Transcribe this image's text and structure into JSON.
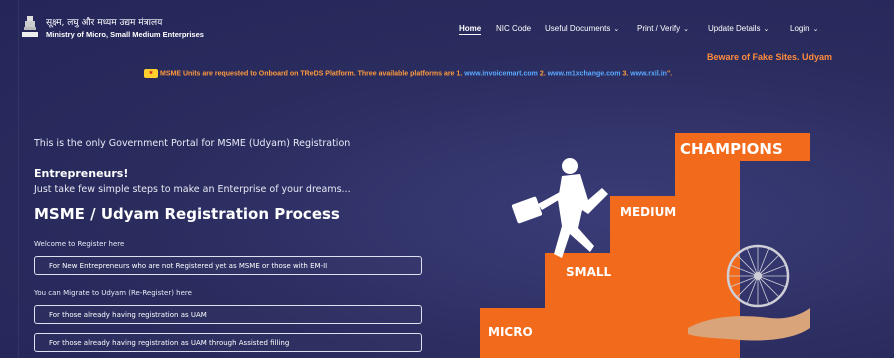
{
  "header": {
    "brand_hindi": "सूक्ष्म, लघु और मध्यम उद्यम मंत्रालय",
    "brand_english": "Ministry of Micro, Small Medium Enterprises",
    "nav": [
      {
        "label": "Home",
        "active": true
      },
      {
        "label": "NIC Code"
      },
      {
        "label": "Useful Documents"
      },
      {
        "label": "Print / Verify"
      },
      {
        "label": "Update Details"
      },
      {
        "label": "Login"
      }
    ]
  },
  "alerts": {
    "fake_warning": "Beware of Fake Sites. Udyam",
    "ticker_text": "MSME Units are requested to Onboard on TReDS Platform. Three available platforms are 1.",
    "ticker_link1": "www.invoicemart.com",
    "ticker_mid1": "2.",
    "ticker_link2": "www.m1xchange.com",
    "ticker_mid2": "3.",
    "ticker_link3": "www.rxil.in",
    "ticker_end": "\"."
  },
  "main": {
    "intro": "This is the only Government Portal for MSME (Udyam) Registration",
    "entre_title": "Entrepreneurs!",
    "entre_sub": "Just take few simple steps to make an Enterprise of your dreams...",
    "process_title": "MSME / Udyam Registration Process",
    "welcome_label": "Welcome to Register here",
    "new_btn": "For New Entrepreneurs who are not Registered yet as MSME or those with EM-II",
    "migrate_label": "You can Migrate to Udyam (Re-Register) here",
    "uam_btn": "For those already having registration as UAM",
    "uam_assisted_btn": "For those already having registration as UAM through Assisted filling"
  },
  "illustration": {
    "step_micro": "MICRO",
    "step_small": "SMALL",
    "step_medium": "MEDIUM",
    "step_champions": "CHAMPIONS",
    "accent": "#f26a1b"
  }
}
